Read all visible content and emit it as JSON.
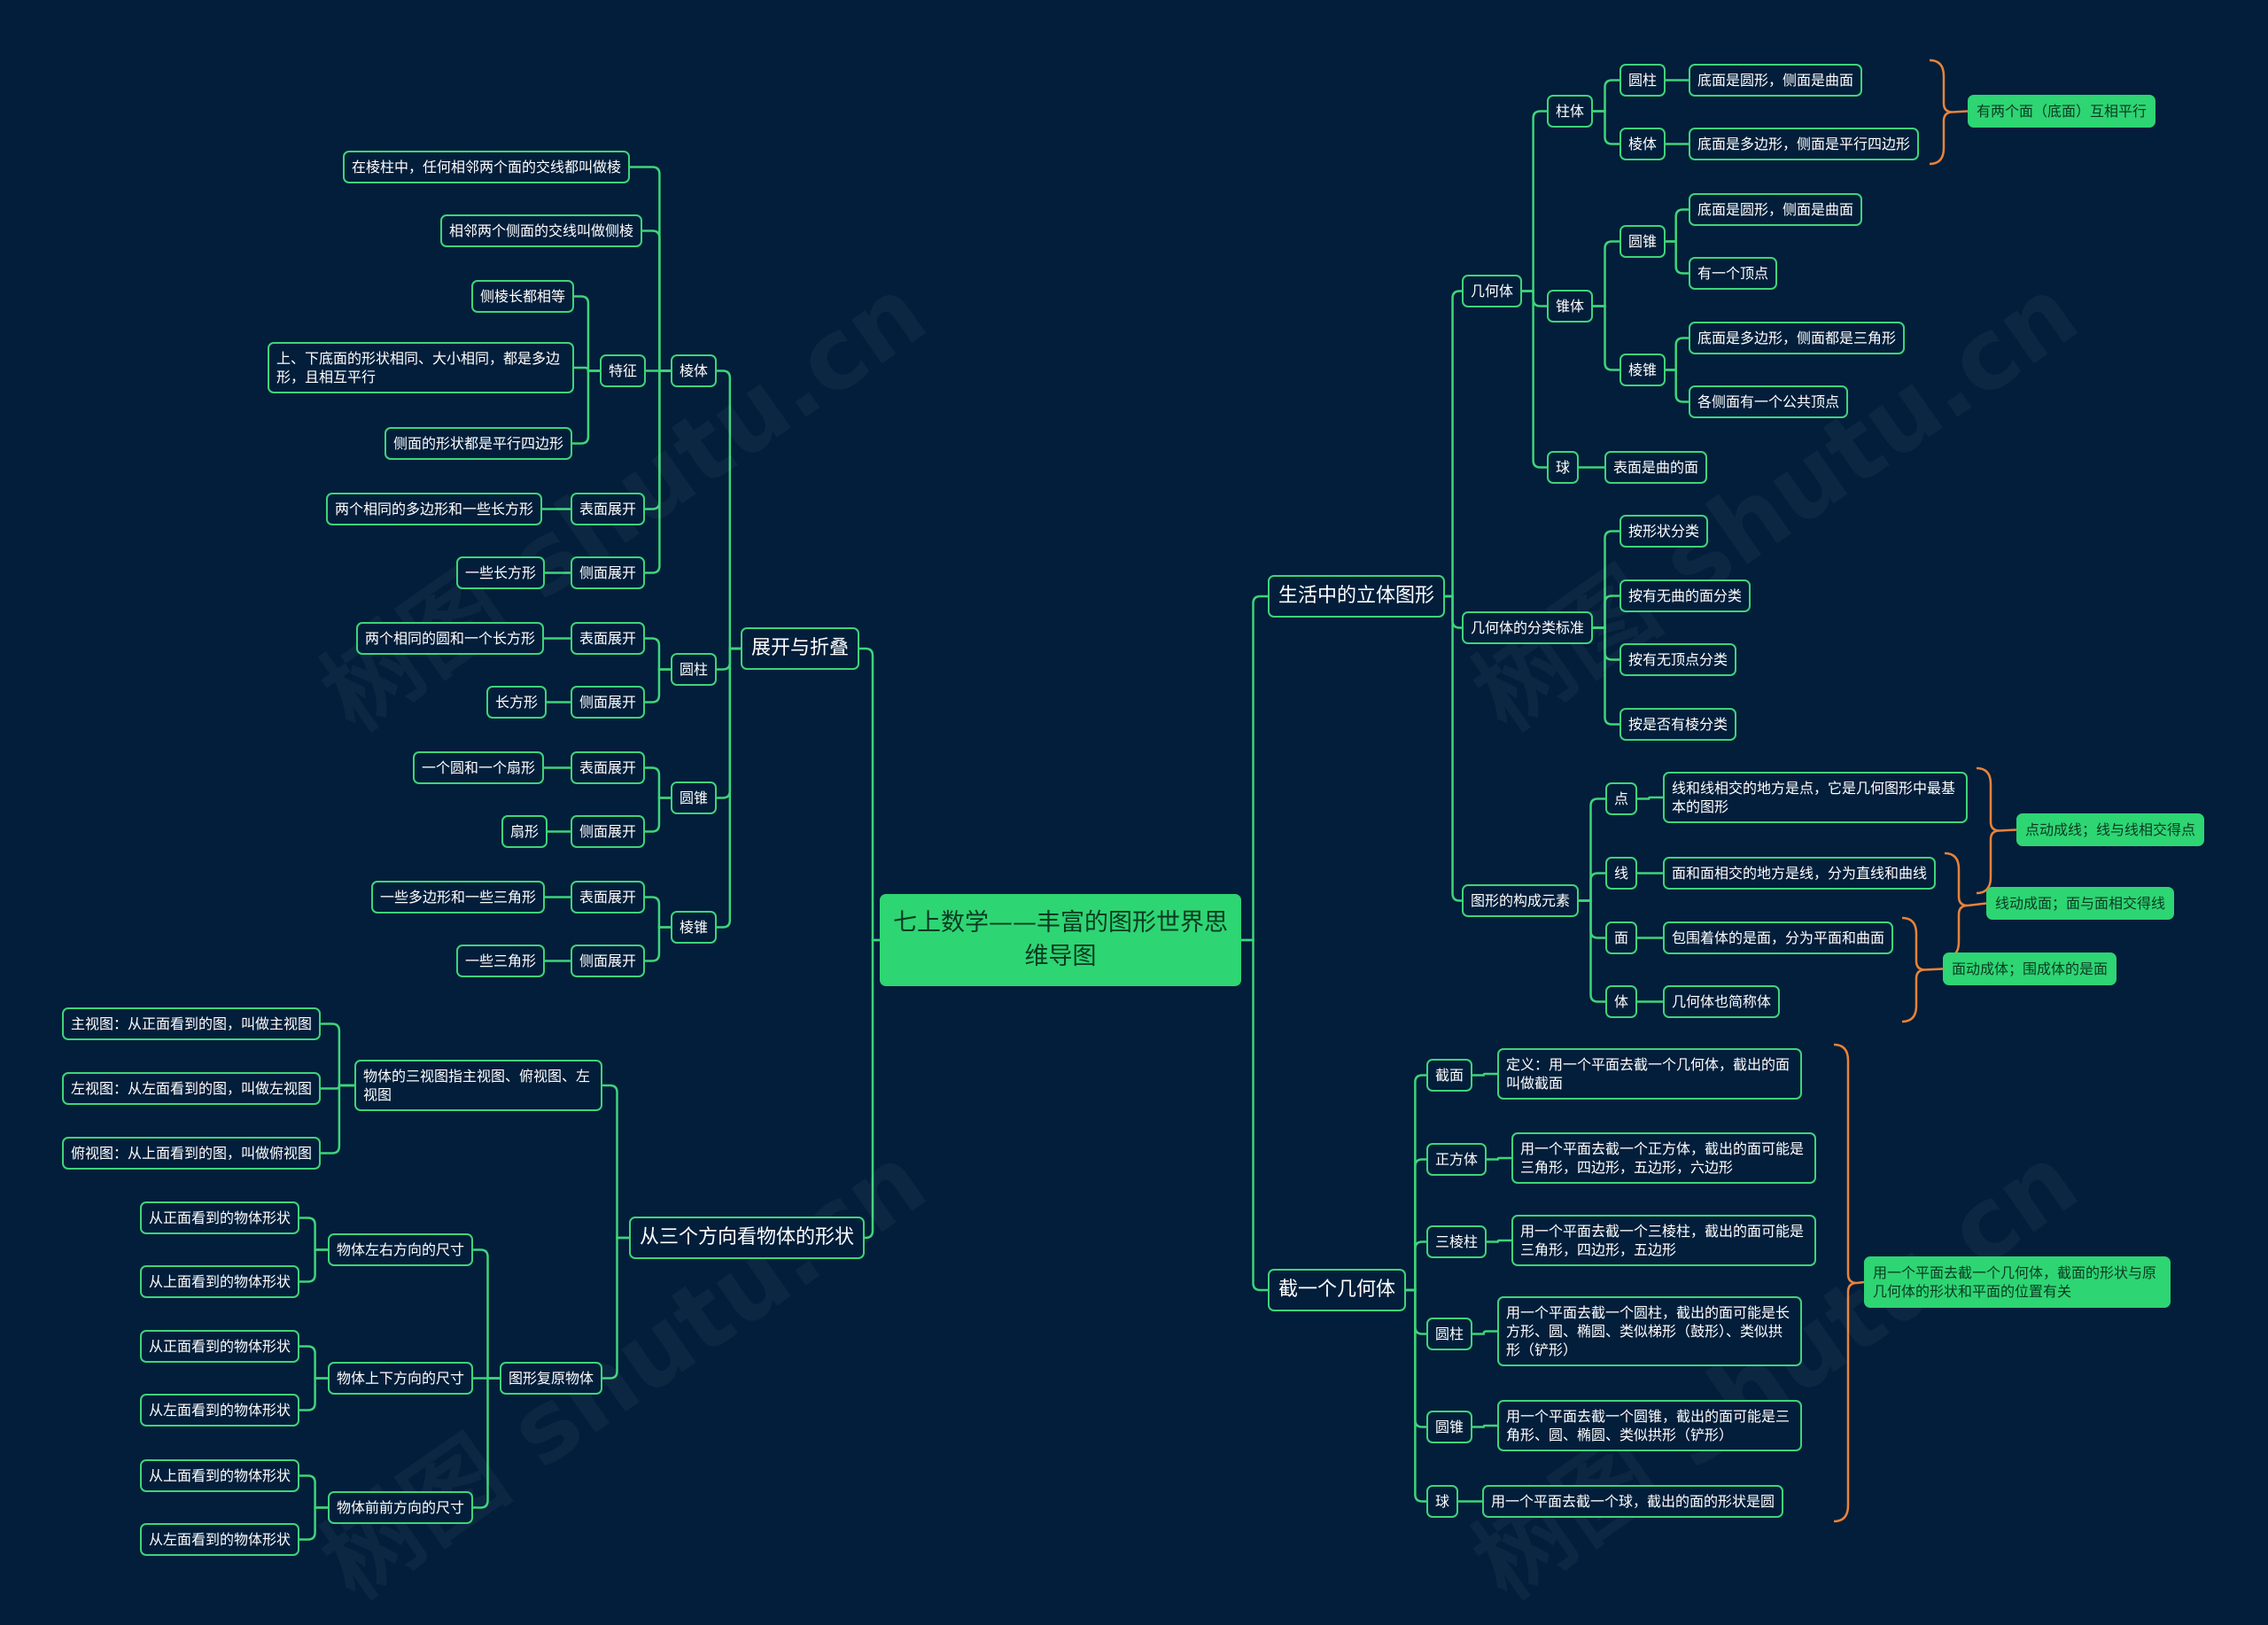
{
  "watermark": "树图 shutu.cn",
  "root": {
    "label": "七上数学——丰富的图形世界思维导图"
  },
  "left": {
    "unfold": {
      "label": "展开与折叠",
      "prism": {
        "label": "棱体",
        "edge_def": "在棱柱中，任何相邻两个面的交线都叫做棱",
        "lateral_edge_def": "相邻两个侧面的交线叫做侧棱",
        "features": {
          "label": "特征",
          "items": [
            "侧棱长都相等",
            "上、下底面的形状相同、大小相同，都是多边形，且相互平行",
            "侧面的形状都是平行四边形"
          ]
        },
        "surface": {
          "label": "表面展开",
          "value": "两个相同的多边形和一些长方形"
        },
        "side": {
          "label": "侧面展开",
          "value": "一些长方形"
        }
      },
      "cylinder": {
        "label": "圆柱",
        "surface": {
          "label": "表面展开",
          "value": "两个相同的圆和一个长方形"
        },
        "side": {
          "label": "侧面展开",
          "value": "长方形"
        }
      },
      "cone": {
        "label": "圆锥",
        "surface": {
          "label": "表面展开",
          "value": "一个圆和一个扇形"
        },
        "side": {
          "label": "侧面展开",
          "value": "扇形"
        }
      },
      "pyramid": {
        "label": "棱锥",
        "surface": {
          "label": "表面展开",
          "value": "一些多边形和一些三角形"
        },
        "side": {
          "label": "侧面展开",
          "value": "一些三角形"
        }
      }
    },
    "views": {
      "label": "从三个方向看物体的形状",
      "three": {
        "label": "物体的三视图指主视图、俯视图、左视图",
        "items": [
          "主视图：从正面看到的图，叫做主视图",
          "左视图：从左面看到的图，叫做左视图",
          "俯视图：从上面看到的图，叫做俯视图"
        ]
      },
      "restore": {
        "label": "图形复原物体",
        "lr": {
          "label": "物体左右方向的尺寸",
          "items": [
            "从正面看到的物体形状",
            "从上面看到的物体形状"
          ]
        },
        "ud": {
          "label": "物体上下方向的尺寸",
          "items": [
            "从正面看到的物体形状",
            "从左面看到的物体形状"
          ]
        },
        "fb": {
          "label": "物体前前方向的尺寸",
          "items": [
            "从上面看到的物体形状",
            "从左面看到的物体形状"
          ]
        }
      }
    }
  },
  "right": {
    "life": {
      "label": "生活中的立体图形",
      "solids": {
        "label": "几何体",
        "column": {
          "label": "柱体",
          "cylinder": {
            "label": "圆柱",
            "value": "底面是圆形，侧面是曲面"
          },
          "prism": {
            "label": "棱体",
            "value": "底面是多边形，侧面是平行四边形"
          },
          "note": "有两个面（底面）互相平行"
        },
        "cone_group": {
          "label": "锥体",
          "cone": {
            "label": "圆锥",
            "items": [
              "底面是圆形，侧面是曲面",
              "有一个顶点"
            ]
          },
          "pyramid": {
            "label": "棱锥",
            "items": [
              "底面是多边形，侧面都是三角形",
              "各侧面有一个公共顶点"
            ]
          }
        },
        "sphere": {
          "label": "球",
          "value": "表面是曲的面"
        }
      },
      "classify": {
        "label": "几何体的分类标准",
        "items": [
          "按形状分类",
          "按有无曲的面分类",
          "按有无顶点分类",
          "按是否有棱分类"
        ]
      },
      "elements": {
        "label": "图形的构成元素",
        "point": {
          "label": "点",
          "value": "线和线相交的地方是点，它是几何图形中最基本的图形"
        },
        "line": {
          "label": "线",
          "value": "面和面相交的地方是线，分为直线和曲线"
        },
        "face": {
          "label": "面",
          "value": "包围着体的是面，分为平面和曲面"
        },
        "body": {
          "label": "体",
          "value": "几何体也简称体"
        },
        "notes": [
          "点动成线；线与线相交得点",
          "线动成面；面与面相交得线",
          "面动成体；围成体的是面"
        ]
      }
    },
    "cut": {
      "label": "截一个几何体",
      "section": {
        "label": "截面",
        "value": "定义：用一个平面去截一个几何体，截出的面叫做截面"
      },
      "cube": {
        "label": "正方体",
        "value": "用一个平面去截一个正方体，截出的面可能是三角形，四边形，五边形，六边形"
      },
      "tri_prism": {
        "label": "三棱柱",
        "value": "用一个平面去截一个三棱柱，截出的面可能是三角形，四边形，五边形"
      },
      "cylinder": {
        "label": "圆柱",
        "value": "用一个平面去截一个圆柱，截出的面可能是长方形、圆、椭圆、类似梯形（鼓形）、类似拱形（铲形）"
      },
      "cone": {
        "label": "圆锥",
        "value": "用一个平面去截一个圆锥，截出的面可能是三角形、圆、椭圆、类似拱形（铲形）"
      },
      "sphere": {
        "label": "球",
        "value": "用一个平面去截一个球，截出的面的形状是圆"
      },
      "note": "用一个平面去截一个几何体，截面的形状与原几何体的形状和平面的位置有关"
    }
  },
  "colors": {
    "background": "#021e3a",
    "line": "#3ed47a",
    "root": "#2ed573",
    "bracket": "#e8833a"
  }
}
